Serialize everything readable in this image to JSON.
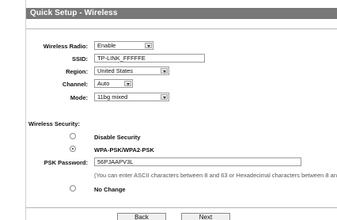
{
  "header": {
    "title": "Quick Setup - Wireless"
  },
  "form": {
    "wireless_radio": {
      "label": "Wireless Radio:",
      "value": "Enable"
    },
    "ssid": {
      "label": "SSID:",
      "value": "TP-LINK_FFFFFE"
    },
    "region": {
      "label": "Region:",
      "value": "United States"
    },
    "channel": {
      "label": "Channel:",
      "value": "Auto"
    },
    "mode": {
      "label": "Mode:",
      "value": "11bg mixed"
    }
  },
  "security": {
    "section_label": "Wireless Security:",
    "options": [
      {
        "label": "Disable Security",
        "checked": false
      },
      {
        "label": "WPA-PSK/WPA2-PSK",
        "checked": true
      },
      {
        "label": "No Change",
        "checked": false
      }
    ],
    "psk_password": {
      "label": "PSK Password:",
      "value": "56PJAAPV3L",
      "note": "(You can enter ASCII characters between 8 and 63 or Hexadecimal characters between 8 and 64.)"
    }
  },
  "buttons": {
    "back": "Back",
    "next": "Next"
  }
}
